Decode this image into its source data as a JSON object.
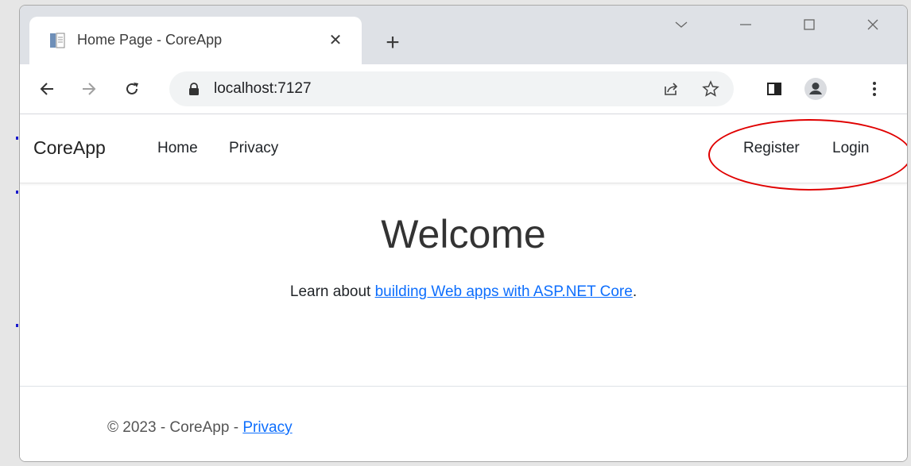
{
  "browser": {
    "tab": {
      "title": "Home Page - CoreApp",
      "close_glyph": "✕"
    },
    "new_tab_glyph": "+",
    "address_bar": {
      "url": "localhost:7127"
    },
    "icons": {
      "favicon": "document-icon",
      "back": "arrow-left-icon",
      "forward": "arrow-right-icon",
      "reload": "reload-icon",
      "lock": "lock-icon",
      "share": "share-icon",
      "bookmark": "star-icon",
      "sidepanel": "side-panel-icon",
      "profile": "profile-icon",
      "menu": "kebab-menu-icon"
    }
  },
  "navbar": {
    "brand": "CoreApp",
    "links": [
      "Home",
      "Privacy"
    ],
    "right_links": [
      "Register",
      "Login"
    ]
  },
  "main": {
    "heading": "Welcome",
    "learn_prefix": "Learn about ",
    "learn_link": "building Web apps with ASP.NET Core",
    "learn_suffix": "."
  },
  "footer": {
    "text": "© 2023 - CoreApp - ",
    "privacy_link": "Privacy"
  },
  "colors": {
    "link": "#0d6efd",
    "annotation": "#e00000",
    "tabstrip": "#dee1e6",
    "omnibox": "#f1f3f4"
  }
}
